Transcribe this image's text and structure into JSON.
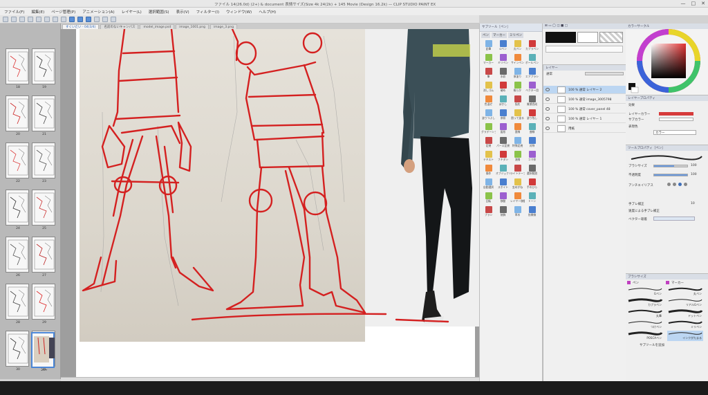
{
  "app": {
    "title": "ファイル 14(26.0d) (2+) & document 表情サイズ(Size 4k 24(2k) + 145 Movie (Design 16.2k) — CLIP STUDIO PAINT EX",
    "window_controls": [
      "—",
      "□",
      "✕"
    ]
  },
  "menu": {
    "items": [
      "ファイル(F)",
      "編集(E)",
      "ページ管理(P)",
      "アニメーション(A)",
      "レイヤー(L)",
      "選択範囲(S)",
      "表示(V)",
      "フィルター(I)",
      "ウィンドウ(W)",
      "ヘルプ(H)"
    ]
  },
  "tabs": [
    {
      "label": "すくいたい - 04(3/4)",
      "active": true
    },
    {
      "label": "名前のないキャンバス",
      "active": false
    },
    {
      "label": "model_image.psd",
      "active": false
    },
    {
      "label": "image_1001.png",
      "active": false
    },
    {
      "label": "image_3.png",
      "active": false
    }
  ],
  "pages": [
    {
      "num": "18"
    },
    {
      "num": "19"
    },
    {
      "num": "20"
    },
    {
      "num": "21"
    },
    {
      "num": "22"
    },
    {
      "num": "23"
    },
    {
      "num": "24"
    },
    {
      "num": "25"
    },
    {
      "num": "26"
    },
    {
      "num": "27"
    },
    {
      "num": "28"
    },
    {
      "num": "29"
    },
    {
      "num": "30"
    },
    {
      "num": "31"
    },
    {
      "num": "24+"
    }
  ],
  "tools_panel": {
    "header": "サブツール［ペン］",
    "subtabs": [
      "ペン",
      "マーカー",
      "ミリペン"
    ],
    "tools": [
      "鉛筆",
      "Gペン",
      "丸ペン",
      "カブラペン",
      "マーカー",
      "ミリペン",
      "サインペン",
      "ボールペン",
      "筆",
      "水彩",
      "厚塗り",
      "エアブラシ",
      "消しゴム",
      "硬め",
      "軟らか",
      "ベクター用",
      "色混ぜ",
      "ぼかし",
      "指先",
      "質感合成",
      "塗りつぶし",
      "参照",
      "囲って塗る",
      "塗り残し",
      "グラデーション",
      "図形",
      "直線",
      "曲線",
      "定規",
      "パース定規",
      "特殊定規",
      "対称",
      "テキスト",
      "フキダシ",
      "流線",
      "コマ枠",
      "操作",
      "オブジェクト",
      "ライトテーブル",
      "選択範囲",
      "自動選択",
      "スポイト",
      "虫めがね",
      "手のひら",
      "回転",
      "移動",
      "レイヤー移動",
      "トーン",
      "ブラシ",
      "装飾",
      "草木",
      "効果線"
    ]
  },
  "layers": {
    "header": "レイヤー",
    "blend_mode": "通常",
    "opacity": "100",
    "rows": [
      {
        "name": "100 % 通常",
        "sub": "レイヤー 2",
        "selected": true
      },
      {
        "name": "100 % 通常",
        "sub": "image_3005798",
        "selected": false
      },
      {
        "name": "100 % 通常",
        "sub": "cover_panel 48",
        "selected": false
      },
      {
        "name": "100 % 通常",
        "sub": "レイヤー 1",
        "selected": false
      },
      {
        "name": "用紙",
        "sub": "",
        "selected": false
      }
    ]
  },
  "color": {
    "header": "カラーサークル",
    "main_color": "#d63a3a",
    "hue_color": "#e23131"
  },
  "layer_props": {
    "header": "レイヤープロパティ",
    "effect_label": "効果",
    "layer_color_label": "レイヤーカラー",
    "sub_color_label": "サブカラー",
    "expression_label": "表現色",
    "expression_value": "カラー"
  },
  "tool_props": {
    "header": "ツールプロパティ［ペン］",
    "brush_size_label": "ブラシサイズ",
    "brush_size_value": "100",
    "opacity_label": "不透明度",
    "opacity_value": "100",
    "antialias_label": "アンチエイリアス",
    "stabilization_label": "手ブレ補正",
    "stabilization_value": "10",
    "speed_label": "速度による手ブレ補正",
    "vector_label": "ベクター吸着"
  },
  "brush_panel": {
    "header": "ブラシサイズ",
    "tabs": [
      "ペン",
      "マーカー"
    ],
    "brushes": [
      {
        "name": "Gペン",
        "selected": false
      },
      {
        "name": "丸ペン",
        "selected": false
      },
      {
        "name": "カブラペン",
        "selected": false
      },
      {
        "name": "リアルGペン",
        "selected": false
      },
      {
        "name": "丸筆",
        "selected": false
      },
      {
        "name": "ドットペン",
        "selected": false
      },
      {
        "name": "つけペン",
        "selected": false
      },
      {
        "name": "ミリペン",
        "selected": false
      },
      {
        "name": "POSCAペン",
        "selected": false
      },
      {
        "name": "インクがたまる",
        "selected": true
      }
    ],
    "footer": "サブツールを追加"
  }
}
